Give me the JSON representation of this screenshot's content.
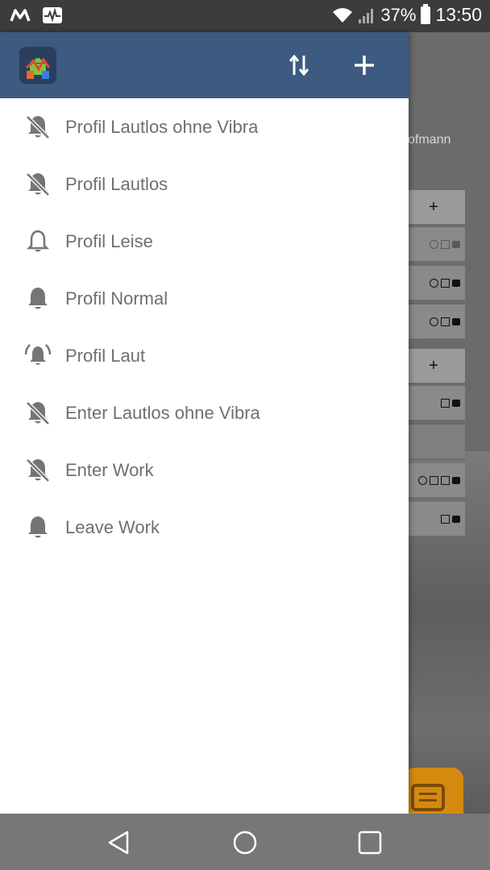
{
  "status_bar": {
    "left_icons": [
      "m-logo-icon",
      "pulse-icon"
    ],
    "battery_percent": "37%",
    "time": "13:50",
    "right_icons": [
      "wifi-icon",
      "signal-icon",
      "battery-icon"
    ]
  },
  "drawer": {
    "header": {
      "app_icon": "android-app-icon",
      "sort_icon": "sort-arrows-icon",
      "add_icon": "plus-icon"
    },
    "items": [
      {
        "label": "Profil Lautlos ohne Vibra",
        "icon": "bell-off-icon"
      },
      {
        "label": "Profil Lautlos",
        "icon": "bell-off-icon"
      },
      {
        "label": "Profil Leise",
        "icon": "bell-outline-icon"
      },
      {
        "label": "Profil Normal",
        "icon": "bell-icon"
      },
      {
        "label": "Profil Laut",
        "icon": "bell-ring-icon"
      },
      {
        "label": "Enter Lautlos ohne Vibra",
        "icon": "bell-off-icon"
      },
      {
        "label": "Enter Work",
        "icon": "bell-off-icon"
      },
      {
        "label": "Leave Work",
        "icon": "bell-icon"
      }
    ]
  },
  "background": {
    "partial_name": "ofmann",
    "header_add_1": "+",
    "header_add_2": "+",
    "fab_icon": "chat-icon"
  },
  "nav_bar": {
    "back_icon": "back-triangle-icon",
    "home_icon": "home-circle-icon",
    "recents_icon": "recents-square-icon"
  },
  "colors": {
    "header_bg": "#3d5a80",
    "status_bg": "#3c3c3c",
    "nav_bg": "#777777",
    "item_text": "#6f6f6f",
    "fab": "#d48a10"
  }
}
